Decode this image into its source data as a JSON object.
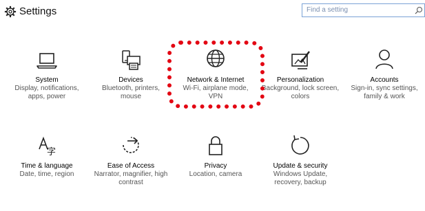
{
  "header": {
    "title": "Settings",
    "search": {
      "placeholder": "Find a setting",
      "value": ""
    }
  },
  "tiles": [
    {
      "title": "System",
      "desc": "Display, notifications, apps, power",
      "icon": "laptop-icon"
    },
    {
      "title": "Devices",
      "desc": "Bluetooth, printers, mouse",
      "icon": "devices-icon"
    },
    {
      "title": "Network & Internet",
      "desc": "Wi-Fi, airplane mode, VPN",
      "icon": "globe-icon"
    },
    {
      "title": "Personalization",
      "desc": "Background, lock screen, colors",
      "icon": "paint-icon"
    },
    {
      "title": "Accounts",
      "desc": "Sign-in, sync settings, family & work",
      "icon": "person-icon"
    },
    {
      "title": "Time & language",
      "desc": "Date, time, region",
      "icon": "time-language-icon"
    },
    {
      "title": "Ease of Access",
      "desc": "Narrator, magnifier, high contrast",
      "icon": "ease-of-access-icon"
    },
    {
      "title": "Privacy",
      "desc": "Location, camera",
      "icon": "lock-icon"
    },
    {
      "title": "Update & security",
      "desc": "Windows Update, recovery, backup",
      "icon": "update-icon"
    }
  ],
  "colors": {
    "accent": "#2a2a2a",
    "highlight": "#e30613",
    "search_border": "#7aa2d6"
  }
}
